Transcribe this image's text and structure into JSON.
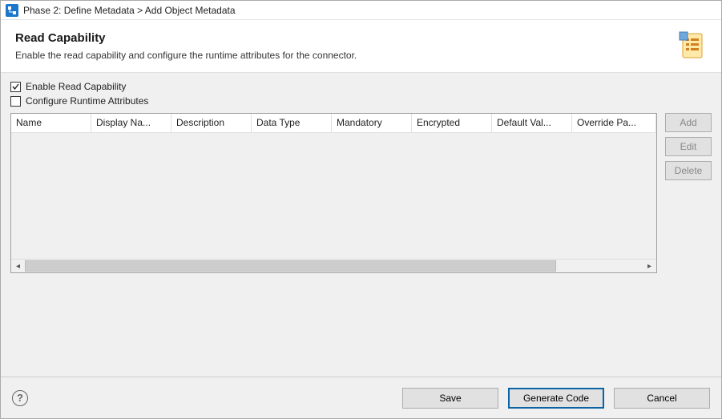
{
  "title": "Phase 2: Define Metadata > Add Object Metadata",
  "banner": {
    "heading": "Read Capability",
    "description": "Enable the read capability and configure the runtime attributes for the connector."
  },
  "checkboxes": {
    "enable_read": {
      "label": "Enable Read Capability",
      "checked": true
    },
    "configure_runtime": {
      "label": "Configure Runtime Attributes",
      "checked": false
    }
  },
  "table": {
    "columns": [
      "Name",
      "Display Na...",
      "Description",
      "Data Type",
      "Mandatory",
      "Encrypted",
      "Default Val...",
      "Override Pa..."
    ],
    "rows": []
  },
  "side_buttons": {
    "add": "Add",
    "edit": "Edit",
    "delete": "Delete"
  },
  "footer": {
    "save": "Save",
    "generate": "Generate Code",
    "cancel": "Cancel"
  }
}
